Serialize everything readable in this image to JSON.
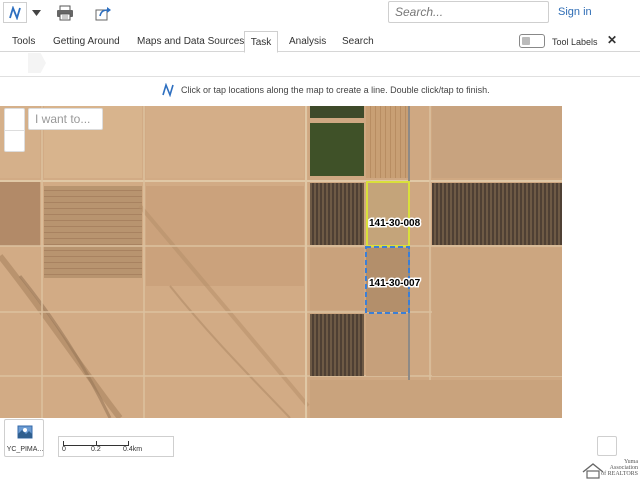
{
  "header": {
    "search_placeholder": "Search...",
    "signin_label": "Sign in"
  },
  "tabs": [
    {
      "label": "Tools"
    },
    {
      "label": "Getting Around"
    },
    {
      "label": "Maps and Data Sources"
    },
    {
      "label": "Task",
      "active": true
    },
    {
      "label": "Analysis"
    },
    {
      "label": "Search"
    }
  ],
  "tool_labels": {
    "label": "Tool Labels",
    "enabled": false
  },
  "close_label": "✕",
  "toolbar": {
    "tools": [
      {
        "icon": "draw-line-icon",
        "selected": true
      },
      {
        "icon": "chevron-down-icon"
      },
      {
        "icon": "print-icon"
      },
      {
        "icon": "share-icon"
      }
    ]
  },
  "instruction": {
    "icon": "draw-line-icon",
    "text": "Click or tap locations along the map to create a line. Double click/tap to finish."
  },
  "map": {
    "i_want_to_placeholder": "I want to...",
    "parcels": [
      {
        "id": "141-30-008",
        "selected": true,
        "color": "#d9e03a"
      },
      {
        "id": "141-30-007",
        "selected": false,
        "color": "#3b7fd6"
      }
    ]
  },
  "basemap": {
    "label": "YC_PIMA..."
  },
  "scale": {
    "ticks": [
      "0",
      "0.2",
      "0.4km"
    ]
  },
  "footer_logo": {
    "text_lines": [
      "Yuma",
      "Association",
      "of REALTORS"
    ]
  }
}
